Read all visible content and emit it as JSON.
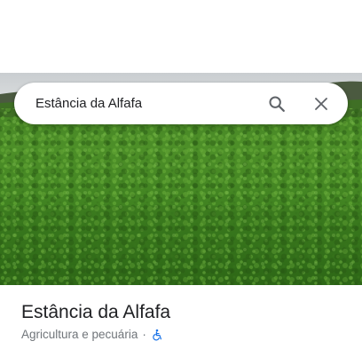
{
  "search": {
    "query": "Estância da Alfafa",
    "search_icon": "search-icon",
    "close_icon": "close-icon"
  },
  "photo": {
    "subject": "alfalfa-field"
  },
  "place": {
    "name": "Estância da Alfafa",
    "category": "Agricultura e pecuária",
    "separator": "·",
    "accessibility_icon": "wheelchair-accessible-icon"
  },
  "colors": {
    "text_primary": "#202124",
    "text_secondary": "#70757a",
    "icon": "#5f6368",
    "accessibility_blue": "#1a73e8"
  }
}
